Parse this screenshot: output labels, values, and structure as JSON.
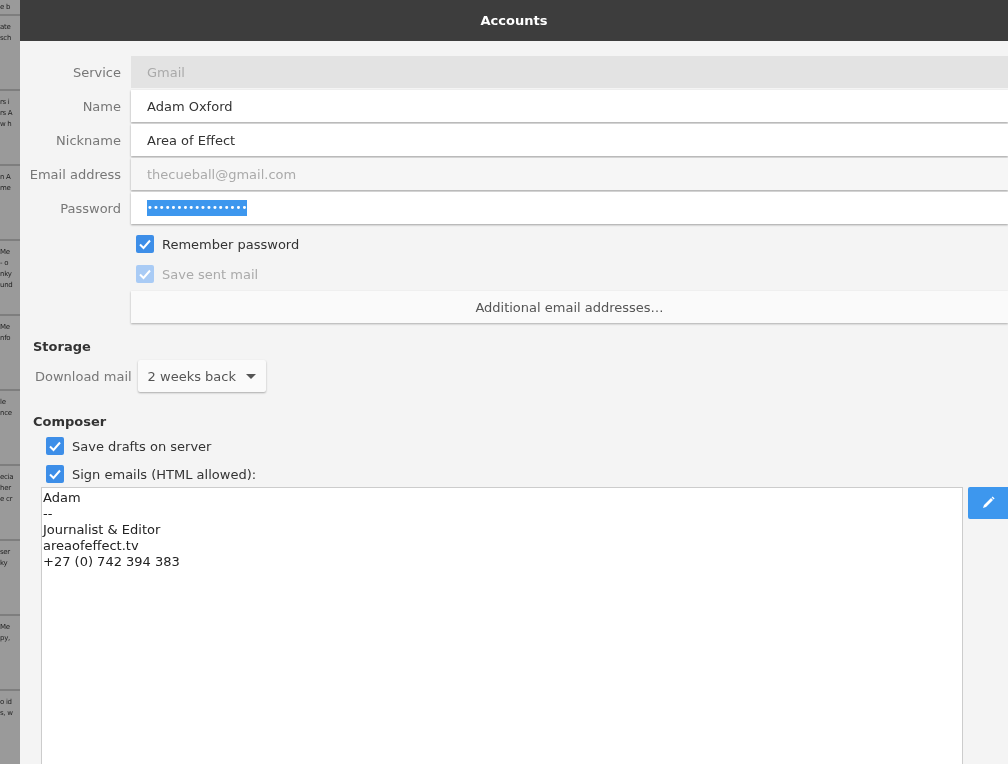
{
  "background_window": {
    "items": [
      {
        "lines": [
          "e b"
        ]
      },
      {
        "lines": [
          "ate",
          "sch"
        ]
      },
      {
        "lines": [
          "rs i",
          "rs A",
          "w h"
        ]
      },
      {
        "lines": [
          "n A",
          "me"
        ]
      },
      {
        "lines": [
          "Me",
          "- o",
          "nky",
          "und"
        ]
      },
      {
        "lines": [
          "Me",
          "nfo"
        ]
      },
      {
        "lines": [
          "le",
          "nce"
        ]
      },
      {
        "lines": [
          "ecia",
          "her",
          "e cr"
        ]
      },
      {
        "lines": [
          "ser",
          "ky"
        ]
      },
      {
        "lines": [
          "Me",
          "py,"
        ]
      },
      {
        "lines": [
          "o id",
          "s, w"
        ]
      }
    ]
  },
  "dialog": {
    "title": "Accounts"
  },
  "fields": [
    {
      "label": "Service",
      "value": "Gmail",
      "disabled": true,
      "kind": "text"
    },
    {
      "label": "Name",
      "value": "Adam Oxford",
      "disabled": false,
      "kind": "text"
    },
    {
      "label": "Nickname",
      "value": "Area of Effect",
      "disabled": false,
      "kind": "text"
    },
    {
      "label": "Email address",
      "value": "thecueball@gmail.com",
      "disabled": true,
      "kind": "text"
    },
    {
      "label": "Password",
      "value": "•••••••••••••••••",
      "disabled": false,
      "kind": "password",
      "text_selected": true
    }
  ],
  "account_options": [
    {
      "label": "Remember password",
      "checked": true,
      "disabled": false
    },
    {
      "label": "Save sent mail",
      "checked": true,
      "disabled": true
    }
  ],
  "additional_button": {
    "label": "Additional email addresses…"
  },
  "storage": {
    "heading": "Storage",
    "download_label": "Download mail",
    "download_value": "2 weeks back"
  },
  "composer": {
    "heading": "Composer",
    "options": [
      {
        "label": "Save drafts on server",
        "checked": true,
        "disabled": false
      },
      {
        "label": "Sign emails (HTML allowed):",
        "checked": true,
        "disabled": false
      }
    ],
    "signature": "Adam\n--\nJournalist & Editor\nareaofeffect.tv\n+27 (0) 742 394 383"
  }
}
